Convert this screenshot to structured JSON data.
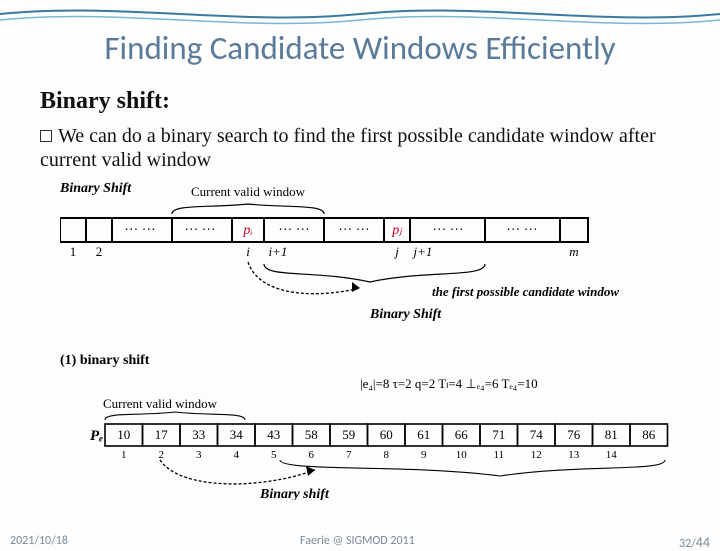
{
  "title": "Finding Candidate Windows Efficiently",
  "subtitle": "Binary shift:",
  "body": "We can do a binary search to find the first possible candidate window after current valid window",
  "diagram1": {
    "caption": "Binary Shift",
    "cvw": "Current valid window",
    "bs": "Binary Shift",
    "fpc": "the first possible candidate window",
    "idx": [
      "1",
      "2",
      "i",
      "i+1",
      "j",
      "j+1",
      "m"
    ],
    "pi": "pᵢ",
    "pj": "pⱼ"
  },
  "diagram2": {
    "section": "(1) binary shift",
    "cvw": "Current valid window",
    "metrics": "|e₄|=8  τ=2  q=2  Tₗ=4  ⊥ₑ₄=6  Tₑ₄=10",
    "Pe": "Pₑ",
    "bs": "Binary shift",
    "values": [
      "10",
      "17",
      "33",
      "34",
      "43",
      "58",
      "59",
      "60",
      "61",
      "66",
      "71",
      "74",
      "76",
      "81",
      "86"
    ],
    "idx": [
      "1",
      "2",
      "3",
      "4",
      "5",
      "6",
      "7",
      "8",
      "9",
      "10",
      "11",
      "12",
      "13",
      "14"
    ]
  },
  "footer": {
    "date": "2021/10/18",
    "venue": "Faerie @ SIGMOD 2011",
    "page": "32/",
    "total": "44"
  }
}
